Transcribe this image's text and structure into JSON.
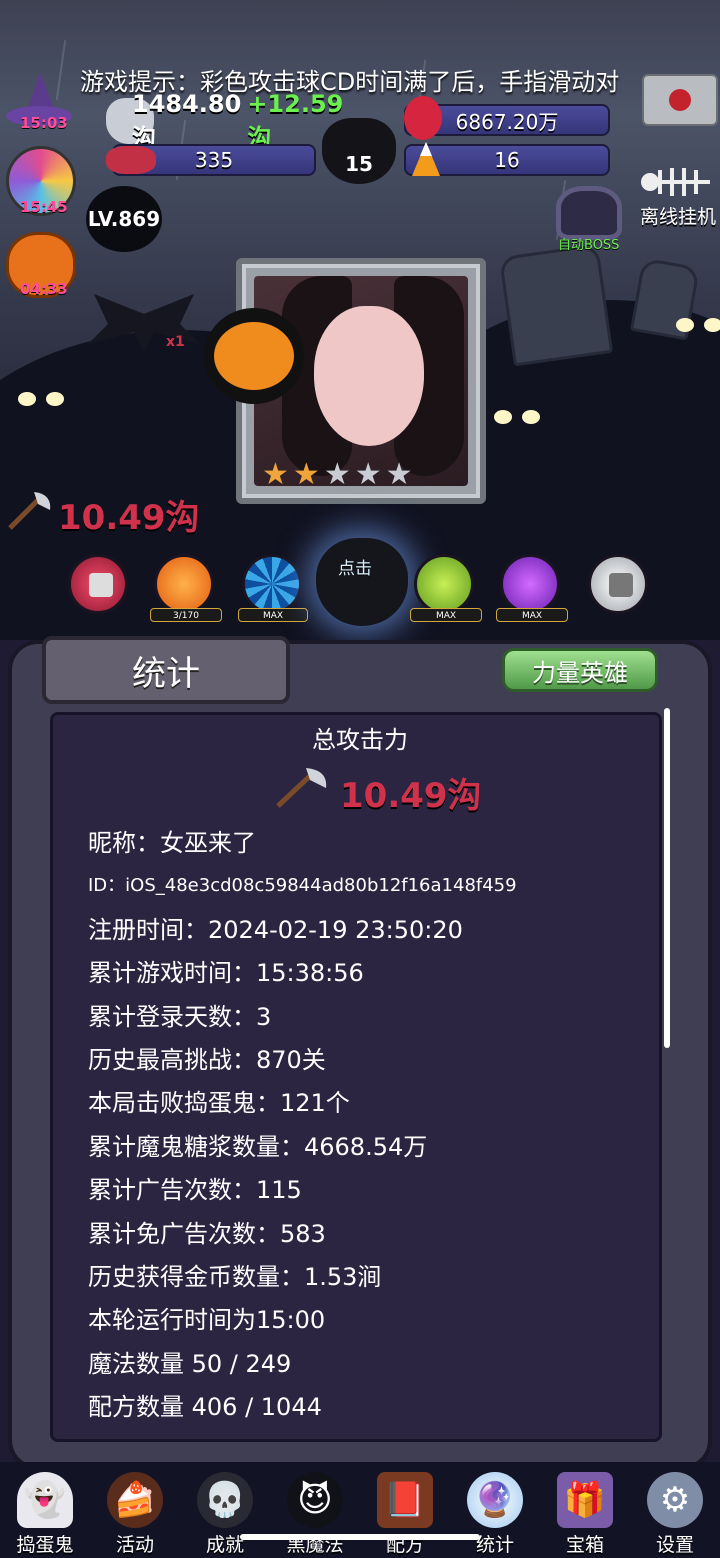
{
  "hud": {
    "tip": "游戏提示：彩色攻击球CD时间满了后，手指滑动对",
    "gold": "1484.80沟",
    "gold_gain": "+12.59沟",
    "syrup": "6867.20万",
    "candy_count": "335",
    "cauldron_count": "15",
    "corn_count": "16",
    "level": "LV.869",
    "timers": [
      "15:03",
      "15:45",
      "04:33"
    ],
    "offline_label": "离线挂机",
    "auto_boss_label": "自动BOSS"
  },
  "battle": {
    "dps": "10.49沟",
    "bat_multiplier": "x1",
    "stars_filled": 2,
    "stars_total": 5
  },
  "skills": [
    {
      "name": "skill-locked-red",
      "tag": ""
    },
    {
      "name": "skill-orange",
      "tag": "3/170"
    },
    {
      "name": "skill-blue",
      "tag": "MAX"
    },
    {
      "name": "skill-click",
      "tag": "点击"
    },
    {
      "name": "skill-green",
      "tag": "MAX"
    },
    {
      "name": "skill-purple",
      "tag": "MAX"
    },
    {
      "name": "skill-locked-gray",
      "tag": ""
    }
  ],
  "panel": {
    "tab_title": "统计",
    "hero_button": "力量英雄",
    "total_title": "总攻击力",
    "total_value": "10.49沟",
    "stats": [
      "昵称：女巫来了",
      "ID：iOS_48e3cd08c59844ad80b12f16a148f459",
      "注册时间：2024-02-19 23:50:20",
      "累计游戏时间：15:38:56",
      "累计登录天数：3",
      "历史最高挑战：870关",
      "本局击败捣蛋鬼：121个",
      "累计魔鬼糖浆数量：4668.54万",
      "累计广告次数：115",
      "累计免广告次数：583",
      "历史获得金币数量：1.53涧",
      "本轮运行时间为15:00",
      "魔法数量 50 / 249",
      "配方数量 406 / 1044"
    ]
  },
  "nav": [
    {
      "label": "捣蛋鬼",
      "icon": "ghost-icon",
      "glyph": "👻"
    },
    {
      "label": "活动",
      "icon": "eyeball-cake-icon",
      "glyph": "🍰"
    },
    {
      "label": "成就",
      "icon": "skull-trophy-icon",
      "glyph": "💀"
    },
    {
      "label": "黑魔法",
      "icon": "demon-icon",
      "glyph": "😈"
    },
    {
      "label": "配方",
      "icon": "spellbook-icon",
      "glyph": "📕"
    },
    {
      "label": "统计",
      "icon": "crystal-ball-icon",
      "glyph": "🔮"
    },
    {
      "label": "宝箱",
      "icon": "gift-box-icon",
      "glyph": "🎁"
    },
    {
      "label": "设置",
      "icon": "gear-icon",
      "glyph": "⚙"
    }
  ],
  "colors": {
    "accent_red": "#d0324c",
    "gain_green": "#6cf04f",
    "hero_button_green": "#6cb85f",
    "panel_bg": "#2c2541"
  }
}
